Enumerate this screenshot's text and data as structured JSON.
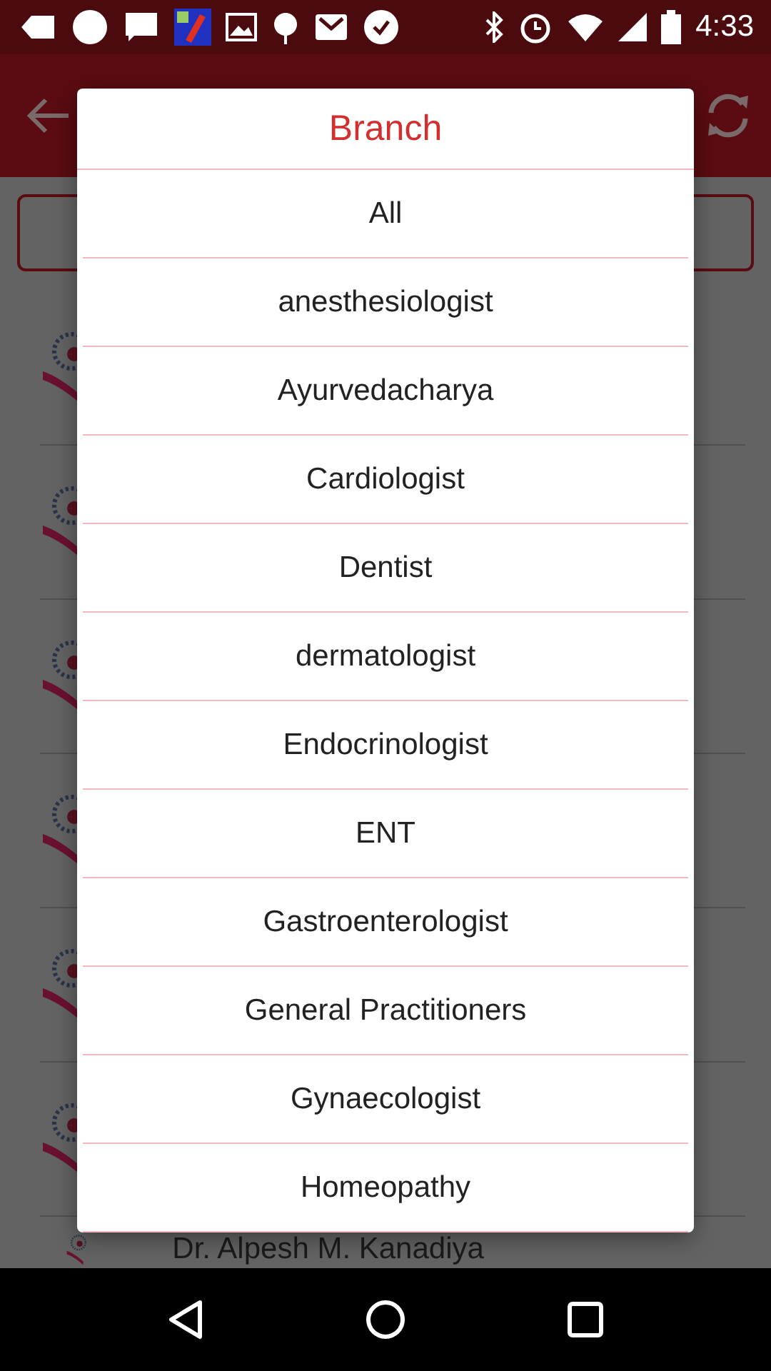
{
  "status_bar": {
    "time": "4:33"
  },
  "list": {
    "rows": [
      {
        "kind": "logo"
      },
      {
        "kind": "logo"
      },
      {
        "kind": "logo"
      },
      {
        "kind": "logo"
      },
      {
        "kind": "logo"
      },
      {
        "kind": "logo"
      }
    ],
    "last_row": {
      "name": "Dr. Alpesh M. Kanadiya"
    }
  },
  "dialog": {
    "title": "Branch",
    "items": [
      {
        "label": "All"
      },
      {
        "label": "anesthesiologist"
      },
      {
        "label": "Ayurvedacharya"
      },
      {
        "label": "Cardiologist"
      },
      {
        "label": "Dentist"
      },
      {
        "label": "dermatologist"
      },
      {
        "label": "Endocrinologist"
      },
      {
        "label": "ENT"
      },
      {
        "label": "Gastroenterologist"
      },
      {
        "label": "General Practitioners"
      },
      {
        "label": "Gynaecologist"
      },
      {
        "label": "Homeopathy"
      }
    ]
  }
}
